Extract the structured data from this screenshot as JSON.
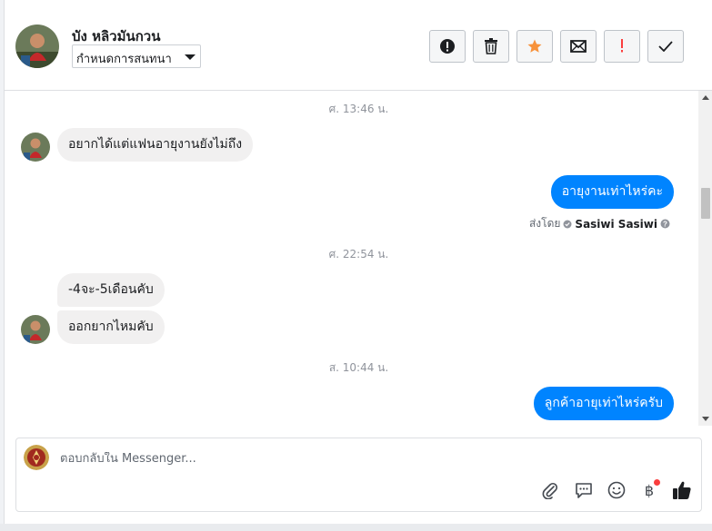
{
  "header": {
    "contact_name": "บัง หลิวมันกวน",
    "label_select": "กำหนดการสนทนา",
    "actions": [
      {
        "name": "report-spam",
        "icon": "alert-circle-icon"
      },
      {
        "name": "delete",
        "icon": "trash-icon"
      },
      {
        "name": "star",
        "icon": "star-icon",
        "color": "#f7923b"
      },
      {
        "name": "mark-unread",
        "icon": "envelope-icon"
      },
      {
        "name": "mark-important",
        "icon": "exclamation-icon",
        "color": "#fa3e3e"
      },
      {
        "name": "mark-done",
        "icon": "checkmark-icon"
      }
    ]
  },
  "thread": {
    "timestamps": [
      "ศ. 13:46 น.",
      "ศ. 22:54 น.",
      "ส. 10:44 น."
    ],
    "messages": [
      {
        "direction": "in",
        "text": "อยากได้แต่แฟนอายุงานยังไม่ถึง"
      },
      {
        "direction": "out",
        "text": "อายุงานเท่าไหร่คะ"
      },
      {
        "direction": "in",
        "text": "-4จะ-5เดือนคับ"
      },
      {
        "direction": "in",
        "text": "ออกยากไหมคับ"
      },
      {
        "direction": "out",
        "text": "ลูกค้าอายุเท่าไหร่ครับ"
      }
    ],
    "sent_by": {
      "prefix": "ส่งโดย",
      "sender": "Sasiwi Sasiwi"
    }
  },
  "composer": {
    "placeholder": "ตอบกลับใน Messenger...",
    "icons": [
      "paperclip-icon",
      "saved-reply-icon",
      "emoji-icon",
      "baht-payment-icon",
      "thumbs-up-icon"
    ]
  },
  "colors": {
    "accent": "#0084ff",
    "incoming_bubble": "#f1f0f0",
    "star": "#f7923b",
    "alert": "#fa3e3e"
  }
}
